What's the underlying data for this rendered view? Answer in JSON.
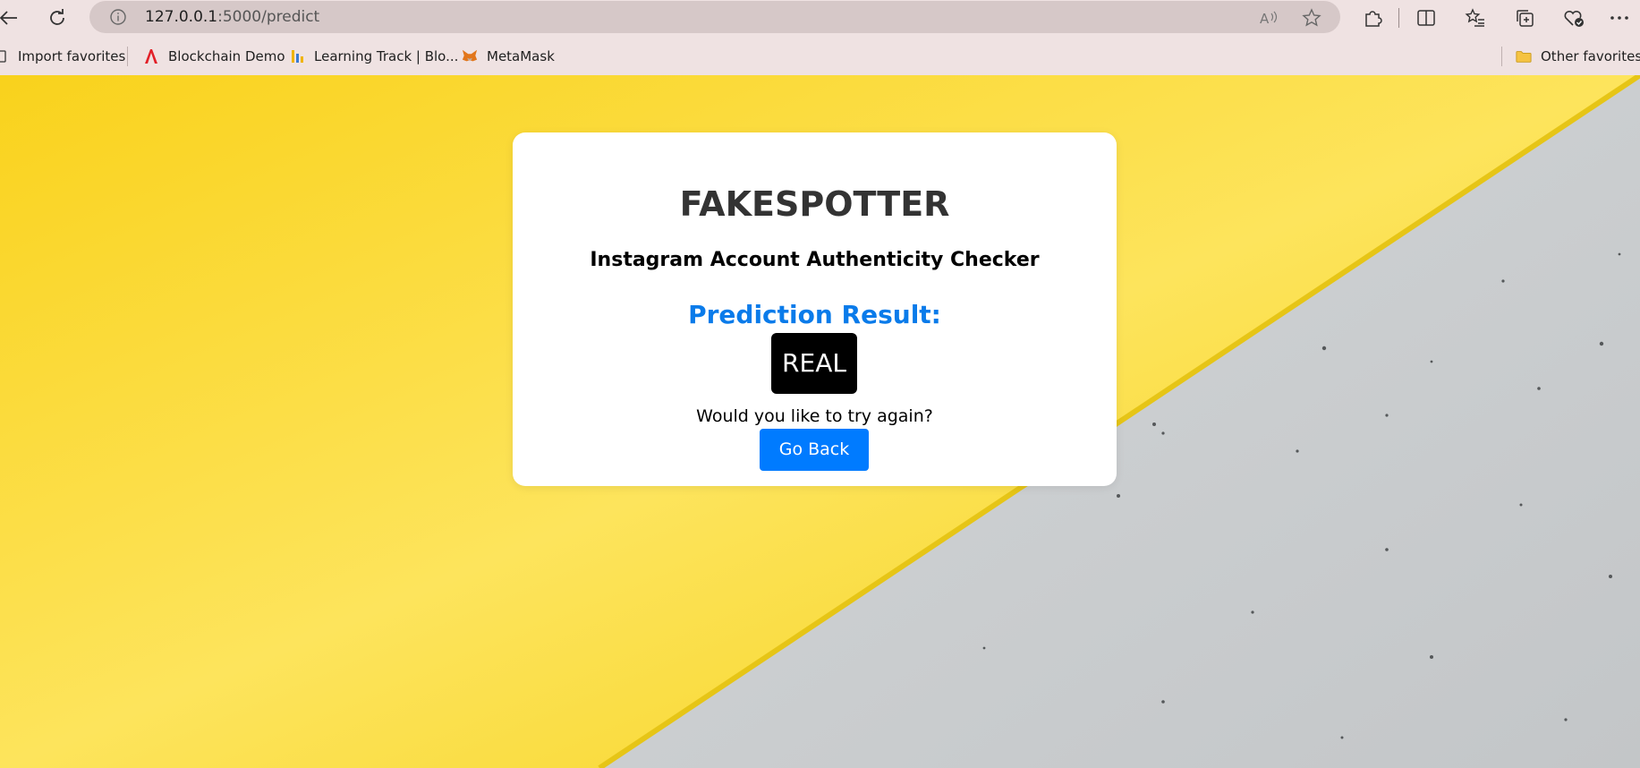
{
  "browser": {
    "address": {
      "host": "127.0.0.1",
      "path": ":5000/predict"
    },
    "bookmarks": [
      {
        "label": "Import favorites",
        "icon": "import-icon"
      },
      {
        "label": "Blockchain Demo",
        "icon": "blockchain-logo-icon"
      },
      {
        "label": "Learning Track | Blo...",
        "icon": "bar-chart-icon"
      },
      {
        "label": "MetaMask",
        "icon": "metamask-fox-icon"
      }
    ],
    "other_favorites": "Other favorites"
  },
  "page": {
    "title": "FAKESPOTTER",
    "subtitle": "Instagram Account Authenticity Checker",
    "result_heading": "Prediction Result:",
    "result_value": "REAL",
    "prompt": "Would you like to try again?",
    "back_button": "Go Back"
  },
  "colors": {
    "accent_blue": "#007bff",
    "heading_blue": "#0a7bea",
    "background_yellow": "#f6d21a",
    "concrete_gray": "#c9ccce",
    "chrome": "#efe2e2"
  }
}
